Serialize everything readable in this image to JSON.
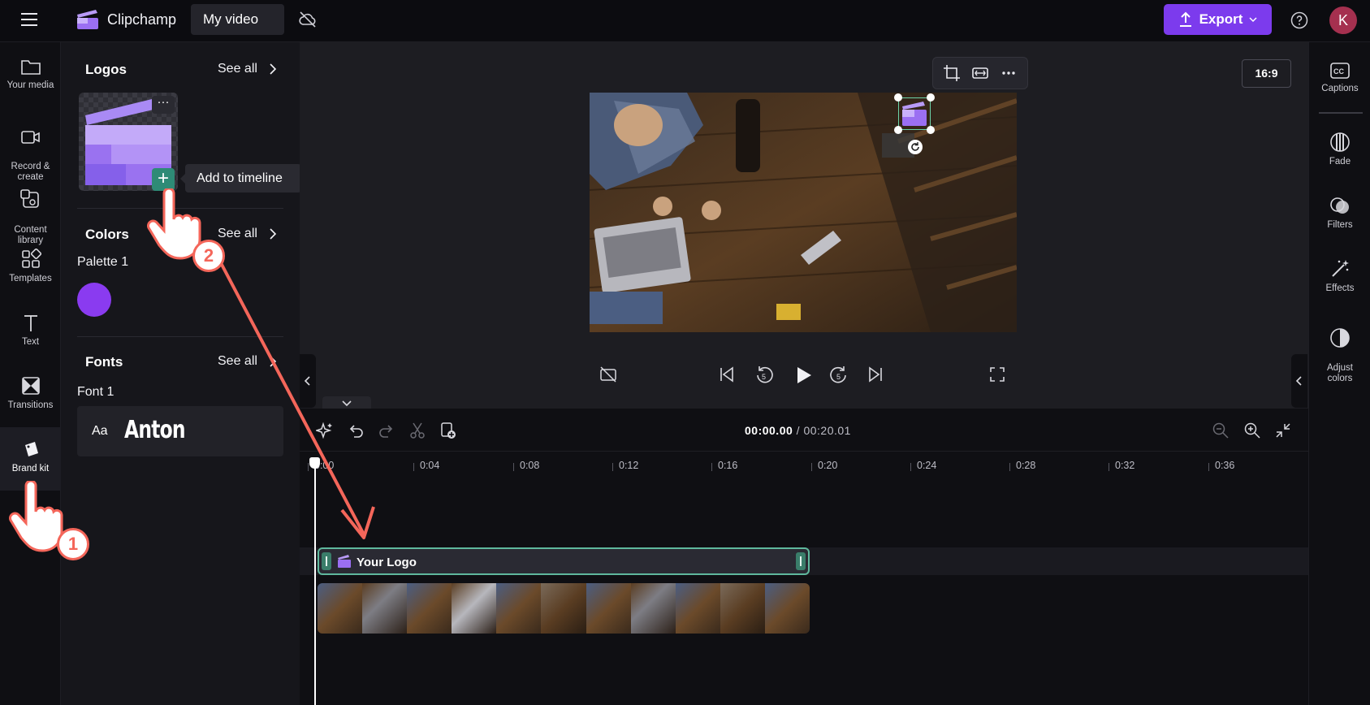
{
  "app": {
    "name": "Clipchamp",
    "project_title": "My video",
    "export_label": "Export",
    "avatar_initial": "K",
    "accent_color": "#7c3bed"
  },
  "left_rail": {
    "items": [
      {
        "label": "Your media",
        "icon": "folder-icon"
      },
      {
        "label": "Record &\ncreate",
        "icon": "camera-icon"
      },
      {
        "label": "Content\nlibrary",
        "icon": "library-icon"
      },
      {
        "label": "Templates",
        "icon": "templates-icon"
      },
      {
        "label": "Text",
        "icon": "text-icon"
      },
      {
        "label": "Transitions",
        "icon": "transitions-icon"
      },
      {
        "label": "Brand kit",
        "icon": "brand-kit-icon",
        "active": true
      }
    ]
  },
  "brand_panel": {
    "logos_title": "Logos",
    "colors_title": "Colors",
    "fonts_title": "Fonts",
    "see_all": "See all",
    "palette_label": "Palette 1",
    "palette_color": "#8a3bf0",
    "font_label": "Font 1",
    "font_prefix": "Aa",
    "font_name": "Anton",
    "tooltip": "Add to timeline",
    "logo_more": "···"
  },
  "preview": {
    "aspect_ratio": "16:9"
  },
  "right_rail": {
    "items": [
      {
        "label": "Captions",
        "icon": "captions-icon"
      },
      {
        "label": "Fade",
        "icon": "fade-icon"
      },
      {
        "label": "Filters",
        "icon": "filters-icon"
      },
      {
        "label": "Effects",
        "icon": "effects-icon"
      },
      {
        "label": "Adjust\ncolors",
        "icon": "adjust-colors-icon"
      }
    ]
  },
  "timeline": {
    "current_time": "00:00.00",
    "total_time": "/ 00:20.01",
    "ticks": [
      "0:00",
      "0:04",
      "0:08",
      "0:12",
      "0:16",
      "0:20",
      "0:24",
      "0:28",
      "0:32",
      "0:36"
    ],
    "logo_clip_label": "Your Logo"
  },
  "annotations": {
    "step1": "1",
    "step2": "2"
  }
}
